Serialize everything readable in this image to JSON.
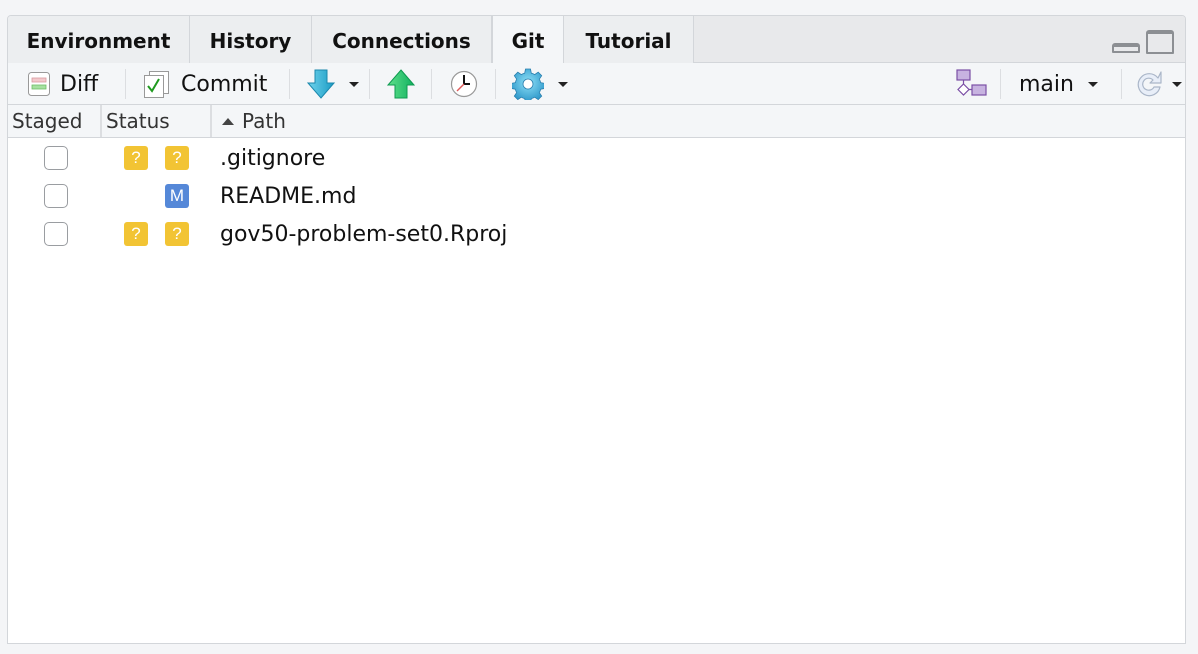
{
  "tabs": [
    {
      "label": "Environment",
      "active": false
    },
    {
      "label": "History",
      "active": false
    },
    {
      "label": "Connections",
      "active": false
    },
    {
      "label": "Git",
      "active": true
    },
    {
      "label": "Tutorial",
      "active": false
    }
  ],
  "window_controls": {
    "minimize_icon": "minimize-icon",
    "maximize_icon": "maximize-icon"
  },
  "toolbar": {
    "diff_label": "Diff",
    "commit_label": "Commit",
    "pull_icon": "pull-arrow-down-icon",
    "push_icon": "push-arrow-up-icon",
    "history_icon": "clock-icon",
    "more_icon": "gear-icon",
    "branch_icon": "branch-icon",
    "branch_name": "main",
    "refresh_icon": "refresh-icon"
  },
  "columns": {
    "staged": "Staged",
    "status": "Status",
    "path": "Path",
    "sort_column": "Path",
    "sort_direction": "ascending"
  },
  "files": [
    {
      "staged": false,
      "status_staged": "?",
      "status_unstaged": "?",
      "path": ".gitignore"
    },
    {
      "staged": false,
      "status_staged": "",
      "status_unstaged": "M",
      "path": "README.md"
    },
    {
      "staged": false,
      "status_staged": "?",
      "status_unstaged": "?",
      "path": "gov50-problem-set0.Rproj"
    }
  ],
  "colors": {
    "untracked_badge": "#f2c434",
    "modified_badge": "#5588d8",
    "branch_icon": "#7b4fa6"
  }
}
